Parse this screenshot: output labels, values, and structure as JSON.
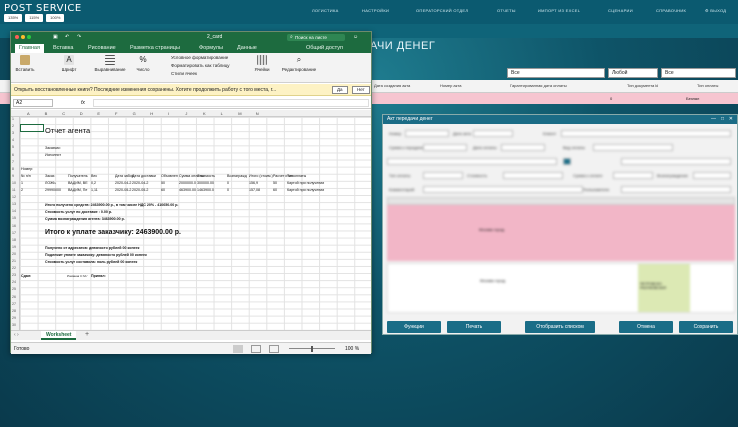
{
  "app": {
    "logo": "POST SERVICE",
    "zoom": [
      "135%",
      "115%",
      "100%"
    ]
  },
  "nav": [
    "ЛОГИСТИКА",
    "НАСТРОЙКИ",
    "ОПЕРАТОРСКИЙ ОТДЕЛ",
    "ОТЧЕТЫ",
    "ИМПОРТ ИЗ EXCEL",
    "СЦЕНАРИИ",
    "СПРАВОЧНИК",
    "⚙ ВЫХОД"
  ],
  "page": {
    "title": "АЧИ ДЕНЕГ"
  },
  "filters": {
    "f1": "Все",
    "f2": "Любой",
    "f3": "Все"
  },
  "grid": {
    "headers": [
      "Дата создания акта",
      "Номер акта",
      "Гарантированная дата оплаты",
      "Тип документа kl",
      "Тип оплаты"
    ],
    "row": {
      "c4": "0",
      "c5": "Безнал"
    }
  },
  "excel": {
    "filename": "2_card",
    "search_placeholder": "Поиск на листе",
    "share": "Общий доступ",
    "tabs": [
      "Главная",
      "Вставка",
      "Рисование",
      "Разметка страницы",
      "Формулы",
      "Данные"
    ],
    "ribbon": {
      "paste": "Вставить",
      "font": "Шрифт",
      "align": "Выравнивание",
      "number": "Число",
      "cond": "Условное форматирование",
      "astable": "Форматировать как таблицу",
      "styles": "Стили ячеек",
      "cells": "Ячейки",
      "editing": "Редактирование"
    },
    "message": "Открыть восстановленные книги?  Последние изменения сохранены. Хотите продолжить работу с того места, г...",
    "yes": "Да",
    "no": "Нет",
    "cellref": "A2",
    "fx": "fx",
    "columns": [
      "A",
      "B",
      "C",
      "D",
      "E",
      "F",
      "G",
      "H",
      "I",
      "J",
      "K",
      "L",
      "M",
      "N"
    ],
    "sheet": {
      "title": "Отчет агента",
      "customer": "Заказчик:",
      "executor": "Исполнит",
      "r7": "Номер:",
      "hdr": [
        "№ п/п",
        "Заказ",
        "Получатель",
        "Вес",
        "Дата забор",
        "Дата доставки",
        "Объявлен",
        "Сумма оплаты",
        "Стоимость",
        "Вознагражд",
        "Итого (стоим.)",
        "Расчет итого",
        "Тип оплаты"
      ],
      "rows": [
        [
          "1",
          "ЛОЖЬ",
          "ВАДИМ, ВЕ",
          "0,2",
          "2020-04-2",
          "2020-04-2",
          "50",
          "2000000.0",
          "300000.00",
          "0",
          "156,9",
          "50",
          "Картой при получении"
        ],
        [
          "2",
          "29990000",
          "ВАДИМ, Пе",
          "1,11",
          "2020-05-2",
          "2020-05-2",
          "60",
          "463900.00",
          "1463900.0",
          "0",
          "157,08",
          "60",
          "Картой при получении"
        ]
      ],
      "sum1": "Итого получено средств: 2463900.00 р., в том числе НДС 20% - 410650.00 р.",
      "sum2": "Стоимость услуг по доставке : 0.00 р.",
      "sum3": "Сумма вознаграждения агента: 3463900.00 р.",
      "pay": "Итого к уплате заказчику: 2463900.00 р.",
      "p1": "Получено от адресатов: девяносто рублей 00 копеек",
      "p2": "Подлежит уплате заказчику: девяносто рублей 00 копеек",
      "p3": "Стоимость услуг составила: ноль рублей 00 копеек",
      "sdal": "Сдал:",
      "prinyal": "Принял:",
      "stamp": "Романов С.М./"
    },
    "sheet_tab": "Worksheet",
    "status_ready": "Готово",
    "zoom": "100 %"
  },
  "akt": {
    "title": "Акт передачи денег",
    "labels": [
      "Номер",
      "Дата акта",
      "Клиент",
      "Сумма к передаче",
      "Дата оплаты",
      "Вид оплаты",
      "Тип оплаты",
      "Стоимость",
      "Сумма к оплате",
      "Вознаграждение",
      "Комментарий",
      "Пользователи"
    ],
    "buttons": {
      "functions": "Функции",
      "print": "Печать",
      "list": "Отобразить списком",
      "cancel": "Отмена",
      "save": "Сохранить"
    },
    "table_row": {
      "c1": "Москва город",
      "c2": "Москва город"
    },
    "rows2_label": "ПЕТРОВСКО-РАЗУМОВСКАЯ"
  }
}
